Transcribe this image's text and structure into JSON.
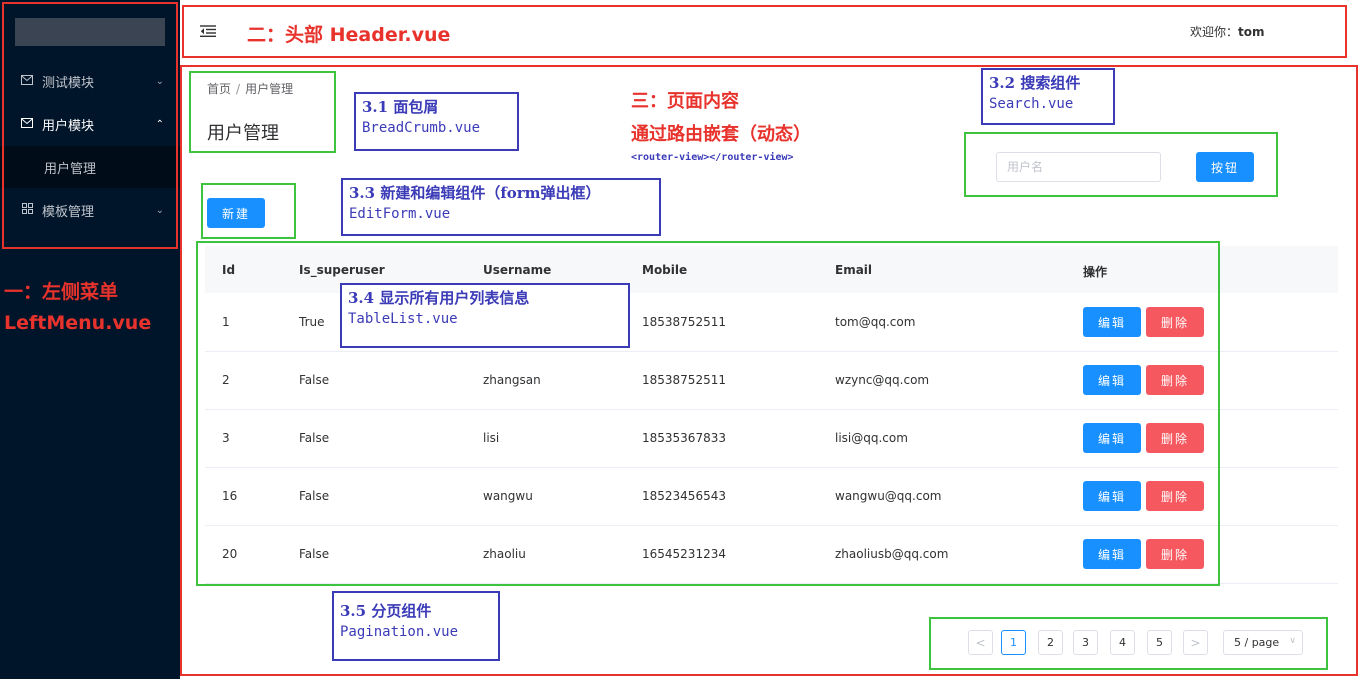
{
  "sidebar": {
    "items": [
      {
        "icon": "mail-icon",
        "label": "测试模块",
        "arrow": "chevron-down"
      },
      {
        "icon": "mail-icon",
        "label": "用户模块",
        "arrow": "chevron-up"
      },
      {
        "label": "用户管理"
      },
      {
        "icon": "grid-icon",
        "label": "模板管理",
        "arrow": "chevron-down"
      }
    ]
  },
  "header": {
    "welcome_prefix": "欢迎你：",
    "username": "tom"
  },
  "breadcrumb": [
    "首页",
    "/",
    "用户管理"
  ],
  "page_title": "用户管理",
  "toolbar": {
    "new_label": "新建"
  },
  "search": {
    "placeholder": "用户名",
    "button_label": "按钮"
  },
  "table": {
    "columns": [
      "Id",
      "Is_superuser",
      "Username",
      "Mobile",
      "Email",
      "操作"
    ],
    "rows": [
      {
        "id": "1",
        "is_superuser": "True",
        "username": "tom",
        "mobile": "18538752511",
        "email": "tom@qq.com"
      },
      {
        "id": "2",
        "is_superuser": "False",
        "username": "zhangsan",
        "mobile": "18538752511",
        "email": "wzync@qq.com"
      },
      {
        "id": "3",
        "is_superuser": "False",
        "username": "lisi",
        "mobile": "18535367833",
        "email": "lisi@qq.com"
      },
      {
        "id": "16",
        "is_superuser": "False",
        "username": "wangwu",
        "mobile": "18523456543",
        "email": "wangwu@qq.com"
      },
      {
        "id": "20",
        "is_superuser": "False",
        "username": "zhaoliu",
        "mobile": "16545231234",
        "email": "zhaoliusb@qq.com"
      }
    ],
    "edit_label": "编辑",
    "delete_label": "删除"
  },
  "pagination": {
    "prev": "<",
    "pages": [
      "1",
      "2",
      "3",
      "4",
      "5"
    ],
    "current": "1",
    "next": ">",
    "page_size": "5 / page"
  },
  "annotations": {
    "left_menu": {
      "line1": "一：左侧菜单",
      "line2": "LeftMenu.vue"
    },
    "header": "二：头部 Header.vue",
    "content": {
      "line1": "三：页面内容",
      "line2": "通过路由嵌套（动态）",
      "line3": "<router-view></router-view>"
    },
    "breadcrumb": {
      "line1": "3.1 面包屑",
      "line2": "BreadCrumb.vue"
    },
    "search": {
      "line1": "3.2 搜索组件",
      "line2": "Search.vue"
    },
    "edit_form": {
      "line1": "3.3 新建和编辑组件（form弹出框）",
      "line2": "EditForm.vue"
    },
    "table_list": {
      "line1": "3.4 显示所有用户列表信息",
      "line2": "TableList.vue"
    },
    "pagination": {
      "line1": "3.5 分页组件",
      "line2": "Pagination.vue"
    }
  },
  "colors": {
    "sidebar_bg": "#001529",
    "primary": "#1890ff",
    "danger": "#f5585f",
    "annotation_red": "#e8322c",
    "annotation_green": "#3ec33e",
    "annotation_blue": "#3b3bb8"
  }
}
